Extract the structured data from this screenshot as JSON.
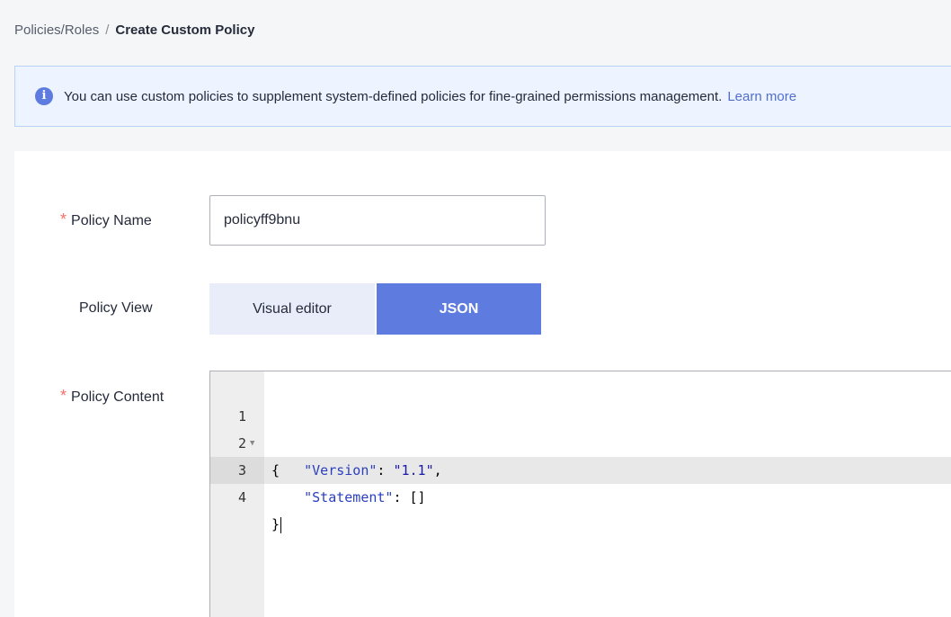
{
  "breadcrumb": {
    "parent": "Policies/Roles",
    "separator": "/",
    "current": "Create Custom Policy"
  },
  "banner": {
    "icon": "info-icon",
    "text": "You can use custom policies to supplement system-defined policies for fine-grained permissions management.",
    "link": "Learn more"
  },
  "form": {
    "required_mark": "*",
    "policy_name": {
      "label": "Policy Name",
      "value": "policyff9bnu"
    },
    "policy_view": {
      "label": "Policy View",
      "options": [
        "Visual editor",
        "JSON"
      ],
      "selected": "JSON"
    },
    "policy_content": {
      "label": "Policy Content",
      "line_numbers": [
        "1",
        "2",
        "3",
        "4"
      ],
      "fold_marker": "▼",
      "lines": [
        {
          "indent": "",
          "key": "",
          "value": "",
          "text": "{"
        },
        {
          "indent": "    ",
          "key": "\"Version\"",
          "sep": ": ",
          "value": "\"1.1\"",
          "tail": ","
        },
        {
          "indent": "    ",
          "key": "\"Statement\"",
          "sep": ": ",
          "value": "[]",
          "tail": ""
        },
        {
          "indent": "",
          "key": "",
          "value": "",
          "text": "}"
        }
      ]
    }
  },
  "colors": {
    "accent": "#5e7ce0",
    "banner_bg": "#edf4ff",
    "required": "#f66f6a",
    "link": "#526ecc"
  }
}
